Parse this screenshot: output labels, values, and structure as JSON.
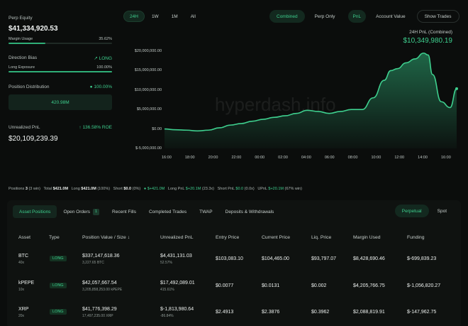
{
  "equity": {
    "label": "Perp Equity",
    "value": "$41,334,920.53",
    "margin_label": "Margin Usage",
    "margin_value": "35.62%",
    "margin_fraction": 0.3562
  },
  "direction": {
    "label": "Direction Bias",
    "value": "LONG",
    "exposure_label": "Long Exposure",
    "exposure_value": "100.00%",
    "exposure_fraction": 1.0
  },
  "distribution": {
    "label": "Position Distribution",
    "value": "100.00%",
    "box_value": "420.98M"
  },
  "upnl": {
    "label": "Unrealized PnL",
    "roe": "136.58% ROE",
    "value": "$20,109,239.39"
  },
  "chart_controls": {
    "ranges": [
      "24H",
      "1W",
      "1M",
      "All"
    ],
    "active_range": "24H",
    "views": [
      "Combined",
      "Perp Only"
    ],
    "metrics": [
      "PnL",
      "Account Value"
    ],
    "show_trades": "Show Trades"
  },
  "pnl_header": {
    "label": "24H PnL (Combined)",
    "value": "$10,349,980.19"
  },
  "watermark": "hyperdash.info",
  "chart_data": {
    "type": "area",
    "yticks": [
      "$20,000,000.00",
      "$15,000,000.00",
      "$10,000,000.00",
      "$5,000,000.00",
      "$0.00",
      "$-5,000,000.00"
    ],
    "xticks": [
      "16:00",
      "18:00",
      "20:00",
      "22:00",
      "00:00",
      "02:00",
      "04:00",
      "06:00",
      "08:00",
      "10:00",
      "12:00",
      "14:00",
      "16:00"
    ],
    "ylim": [
      -5000000,
      20000000
    ],
    "x": [
      0,
      0.5,
      1,
      1.5,
      2,
      2.5,
      3,
      3.5,
      4,
      4.5,
      5,
      5.5,
      6,
      6.5,
      7,
      7.5,
      8,
      8.5,
      9,
      9.5,
      10,
      10.3,
      10.6,
      11,
      11.4,
      11.8,
      12,
      12.2,
      12.6,
      13,
      13.3
    ],
    "values": [
      0,
      -200000,
      -300000,
      -500000,
      -300000,
      300000,
      1000000,
      1400000,
      2000000,
      2500000,
      3000000,
      3400000,
      4000000,
      4800000,
      4500000,
      4000000,
      4500000,
      5000000,
      5000000,
      8000000,
      12500000,
      15000000,
      15500000,
      17000000,
      18000000,
      19500000,
      19000000,
      14000000,
      7000000,
      5500000,
      10350000
    ]
  },
  "summary": {
    "positions_label": "Positions",
    "positions_value": "3",
    "positions_note": "(3 win)",
    "total_label": "Total",
    "total_value": "$421.0M",
    "long_label": "Long",
    "long_value": "$421.0M",
    "long_pct": "(100%)",
    "short_label": "Short",
    "short_value": "$0.0",
    "short_pct": "(0%)",
    "net_value": "$+421.0M",
    "long_pnl_label": "Long PnL",
    "long_pnl_value": "$+20.1M",
    "long_pnl_note": "(23.3x)",
    "short_pnl_label": "Short PnL",
    "short_pnl_value": "$0.0",
    "short_pnl_note": "(0.0x)",
    "upnl_label": "UPnL",
    "upnl_value": "$+20.1M",
    "upnl_note": "(67% win)"
  },
  "tabs": [
    {
      "label": "Asset Positions",
      "active": true
    },
    {
      "label": "Open Orders",
      "badge": "1"
    },
    {
      "label": "Recent Fills"
    },
    {
      "label": "Completed Trades"
    },
    {
      "label": "TWAP"
    },
    {
      "label": "Deposits & Withdrawals"
    }
  ],
  "market_tabs": [
    "Perpetual",
    "Spot"
  ],
  "columns": [
    "Asset",
    "Type",
    "Position Value / Size",
    "Unrealized PnL",
    "Entry Price",
    "Current Price",
    "Liq. Price",
    "Margin Used",
    "Funding"
  ],
  "sort_icon": "arrow-down-icon",
  "rows": [
    {
      "asset": "BTC",
      "lev": "40x",
      "type": "LONG",
      "value": "$337,147,618.36",
      "size": "3,227.65 BTC",
      "pnl": "$4,431,131.03",
      "pnl_pct": "52.57%",
      "pnl_sign": "pos",
      "entry": "$103,083.10",
      "current": "$104,465.00",
      "liq": "$93,797.07",
      "margin": "$8,428,690.46",
      "funding": "$-699,839.23"
    },
    {
      "asset": "kPEPE",
      "lev": "10x",
      "type": "LONG",
      "value": "$42,057,667.54",
      "size": "3,205,858,253.00 kPEPE",
      "pnl": "$17,492,089.01",
      "pnl_pct": "415.61%",
      "pnl_sign": "pos",
      "entry": "$0.0077",
      "current": "$0.0131",
      "liq": "$0.002",
      "margin": "$4,205,766.75",
      "funding": "$-1,056,820.27"
    },
    {
      "asset": "XRP",
      "lev": "20x",
      "type": "LONG",
      "value": "$41,776,398.29",
      "size": "17,497,235.00 XRP",
      "pnl": "$-1,813,980.64",
      "pnl_pct": "-86.84%",
      "pnl_sign": "neg",
      "entry": "$2.4913",
      "current": "$2.3876",
      "liq": "$0.3962",
      "margin": "$2,088,819.91",
      "funding": "$-147,962.75"
    }
  ],
  "colors": {
    "accent": "#3ecf8e",
    "negative": "#ef5350",
    "background": "#0b0d0c"
  }
}
